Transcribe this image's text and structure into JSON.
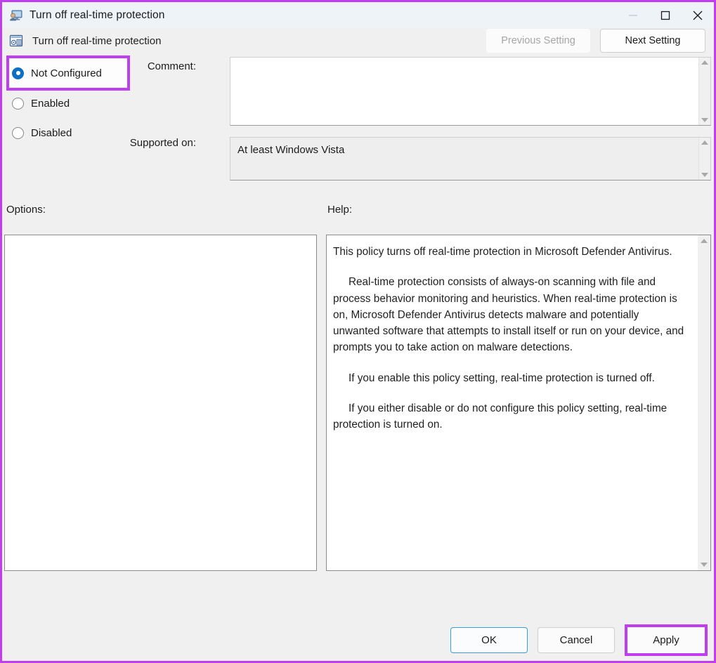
{
  "window": {
    "title": "Turn off real-time protection",
    "icon": "monitor-user-icon",
    "controls": {
      "minimize": "minimize-icon",
      "maximize": "maximize-icon",
      "close": "close-icon"
    }
  },
  "header": {
    "policy_name": "Turn off real-time protection",
    "icon": "group-policy-setting-icon",
    "previous_setting_label": "Previous Setting",
    "next_setting_label": "Next Setting",
    "previous_setting_enabled": false,
    "next_setting_enabled": true
  },
  "state_options": {
    "selected": "Not Configured",
    "items": [
      {
        "label": "Not Configured",
        "checked": true,
        "highlighted": true
      },
      {
        "label": "Enabled",
        "checked": false,
        "highlighted": false
      },
      {
        "label": "Disabled",
        "checked": false,
        "highlighted": false
      }
    ]
  },
  "fields": {
    "comment_label": "Comment:",
    "comment_value": "",
    "supported_label": "Supported on:",
    "supported_value": "At least Windows Vista"
  },
  "panes": {
    "options_label": "Options:",
    "options_content": "",
    "help_label": "Help:",
    "help_paragraphs": [
      "This policy turns off real-time protection in Microsoft Defender Antivirus.",
      "Real-time protection consists of always-on scanning with file and process behavior monitoring and heuristics. When real-time protection is on, Microsoft Defender Antivirus detects malware and potentially unwanted software that attempts to install itself or run on your device, and prompts you to take action on malware detections.",
      "If you enable this policy setting, real-time protection is turned off.",
      "If you either disable or do not configure this policy setting, real-time protection is turned on."
    ]
  },
  "footer": {
    "ok_label": "OK",
    "cancel_label": "Cancel",
    "apply_label": "Apply"
  },
  "colors": {
    "highlight": "#c13ef0",
    "accent_blue": "#0d6fc4",
    "focus_blue": "#3a9ede",
    "titlebar_bg": "#eef3f8",
    "dialog_bg": "#f0f0f0"
  }
}
